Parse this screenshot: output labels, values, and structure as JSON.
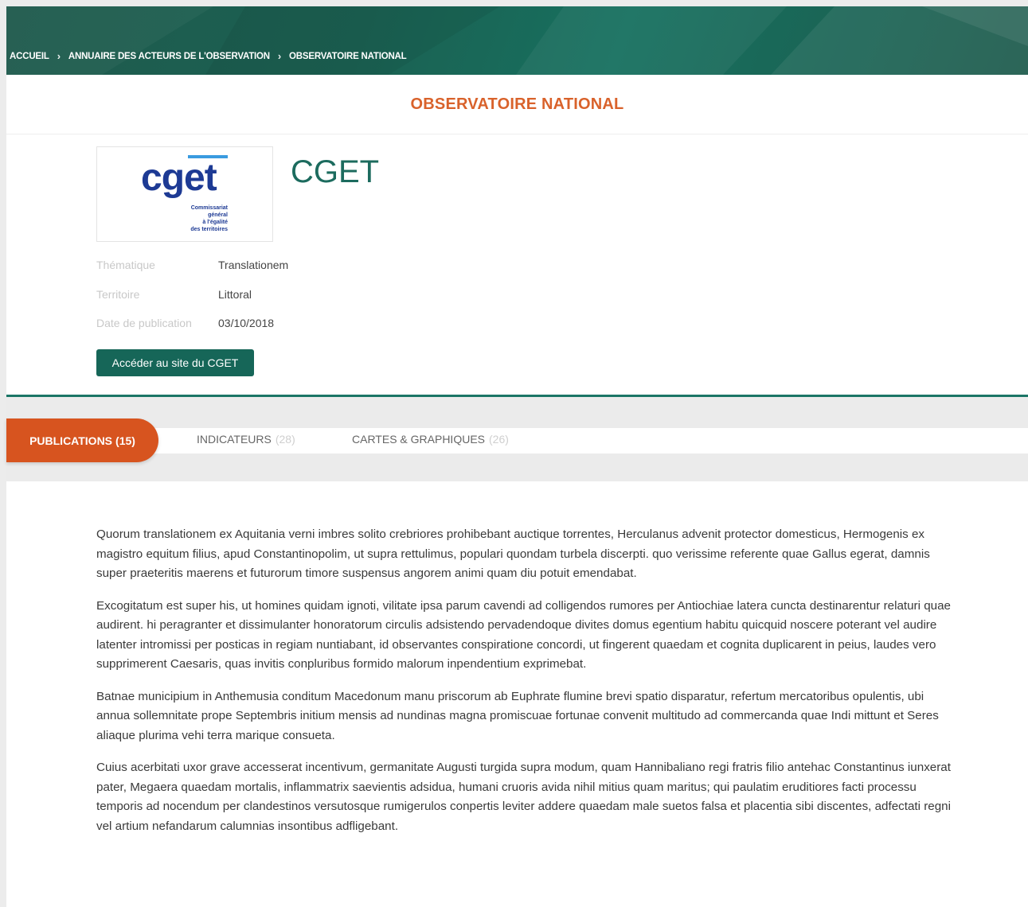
{
  "breadcrumb": {
    "items": [
      "ACCUEIL",
      "ANNUAIRE DES ACTEURS DE L'OBSERVATION",
      "OBSERVATOIRE NATIONAL"
    ],
    "separator": "›"
  },
  "header": {
    "title": "OBSERVATOIRE NATIONAL"
  },
  "organization": {
    "name": "CGET",
    "logo_text": "cget",
    "logo_subtext": [
      "Commissariat",
      "général",
      "à l'égalité",
      "des territoires"
    ],
    "fields": [
      {
        "label": "Thématique",
        "value": "Translationem"
      },
      {
        "label": "Territoire",
        "value": "Littoral"
      },
      {
        "label": "Date de publication",
        "value": "03/10/2018"
      }
    ],
    "site_button_label": "Accéder au site du CGET"
  },
  "tabs": [
    {
      "label": "PUBLICATIONS",
      "count": "(15)",
      "active": true
    },
    {
      "label": "INDICATEURS",
      "count": "(28)",
      "active": false
    },
    {
      "label": "CARTES & GRAPHIQUES",
      "count": "(26)",
      "active": false
    }
  ],
  "content": {
    "paragraphs": [
      "Quorum translationem ex Aquitania verni imbres solito crebriores prohibebant auctique torrentes, Herculanus advenit protector domesticus, Hermogenis ex magistro equitum filius, apud Constantinopolim, ut supra rettulimus, populari quondam turbela discerpti. quo verissime referente quae Gallus egerat, damnis super praeteritis maerens et futurorum timore suspensus angorem animi quam diu potuit emendabat.",
      "Excogitatum est super his, ut homines quidam ignoti, vilitate ipsa parum cavendi ad colligendos rumores per Antiochiae latera cuncta destinarentur relaturi quae audirent. hi peragranter et dissimulanter honoratorum circulis adsistendo pervadendoque divites domus egentium habitu quicquid noscere poterant vel audire latenter intromissi per posticas in regiam nuntiabant, id observantes conspiratione concordi, ut fingerent quaedam et cognita duplicarent in peius, laudes vero supprimerent Caesaris, quas invitis conpluribus formido malorum inpendentium exprimebat.",
      "Batnae municipium in Anthemusia conditum Macedonum manu priscorum ab Euphrate flumine brevi spatio disparatur, refertum mercatoribus opulentis, ubi annua sollemnitate prope Septembris initium mensis ad nundinas magna promiscuae fortunae convenit multitudo ad commercanda quae Indi mittunt et Seres aliaque plurima vehi terra marique consueta.",
      "Cuius acerbitati uxor grave accesserat incentivum, germanitate Augusti turgida supra modum, quam Hannibaliano regi fratris filio antehac Constantinus iunxerat pater, Megaera quaedam mortalis, inflammatrix saevientis adsidua, humani cruoris avida nihil mitius quam maritus; qui paulatim eruditiores facti processu temporis ad nocendum per clandestinos versutosque rumigerulos conpertis leviter addere quaedam male suetos falsa et placentia sibi discentes, adfectati regni vel artium nefandarum calumnias insontibus adfligebant."
    ]
  },
  "colors": {
    "header_green": "#1b6152",
    "accent_orange": "#d7541f",
    "title_orange": "#d9622b",
    "button_green": "#166658"
  }
}
